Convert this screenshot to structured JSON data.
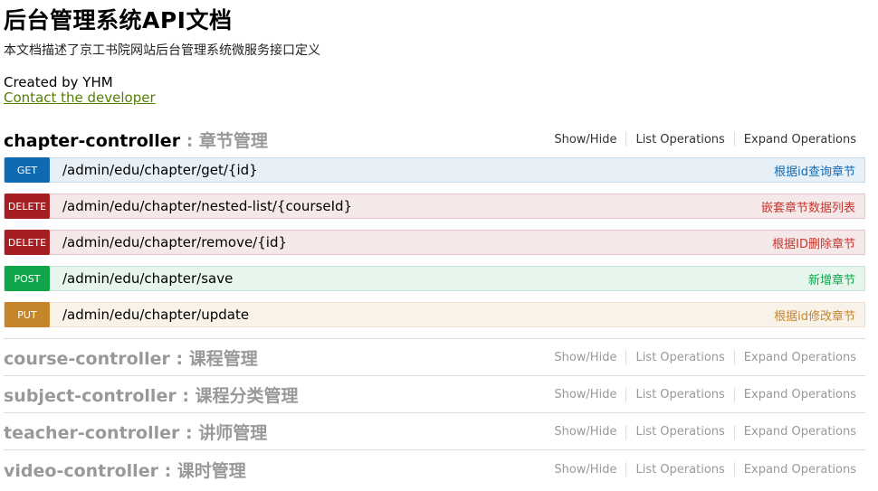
{
  "info": {
    "title": "后台管理系统API文档",
    "description": "本文档描述了京工书院网站后台管理系统微服务接口定义",
    "created_by": "Created by YHM",
    "contact": "Contact the developer"
  },
  "resource_links": {
    "show_hide": "Show/Hide",
    "list_operations": "List Operations",
    "expand_operations": "Expand Operations"
  },
  "resources": [
    {
      "name": "chapter-controller",
      "separator": " : ",
      "description": "章节管理",
      "operations": [
        {
          "method": "GET",
          "path": "/admin/edu/chapter/get/{id}",
          "summary": "根据id查询章节"
        },
        {
          "method": "DELETE",
          "path": "/admin/edu/chapter/nested-list/{courseId}",
          "summary": "嵌套章节数据列表"
        },
        {
          "method": "DELETE",
          "path": "/admin/edu/chapter/remove/{id}",
          "summary": "根据ID删除章节"
        },
        {
          "method": "POST",
          "path": "/admin/edu/chapter/save",
          "summary": "新增章节"
        },
        {
          "method": "PUT",
          "path": "/admin/edu/chapter/update",
          "summary": "根据id修改章节"
        }
      ]
    },
    {
      "name": "course-controller",
      "separator": " : ",
      "description": "课程管理"
    },
    {
      "name": "subject-controller",
      "separator": " : ",
      "description": "课程分类管理"
    },
    {
      "name": "teacher-controller",
      "separator": " : ",
      "description": "讲师管理"
    },
    {
      "name": "video-controller",
      "separator": " : ",
      "description": "课时管理"
    }
  ],
  "colors": {
    "get": "#0f6ab4",
    "delete": "#a41e22",
    "post": "#10a54a",
    "put": "#c5862b",
    "contact_link": "#547f00"
  }
}
